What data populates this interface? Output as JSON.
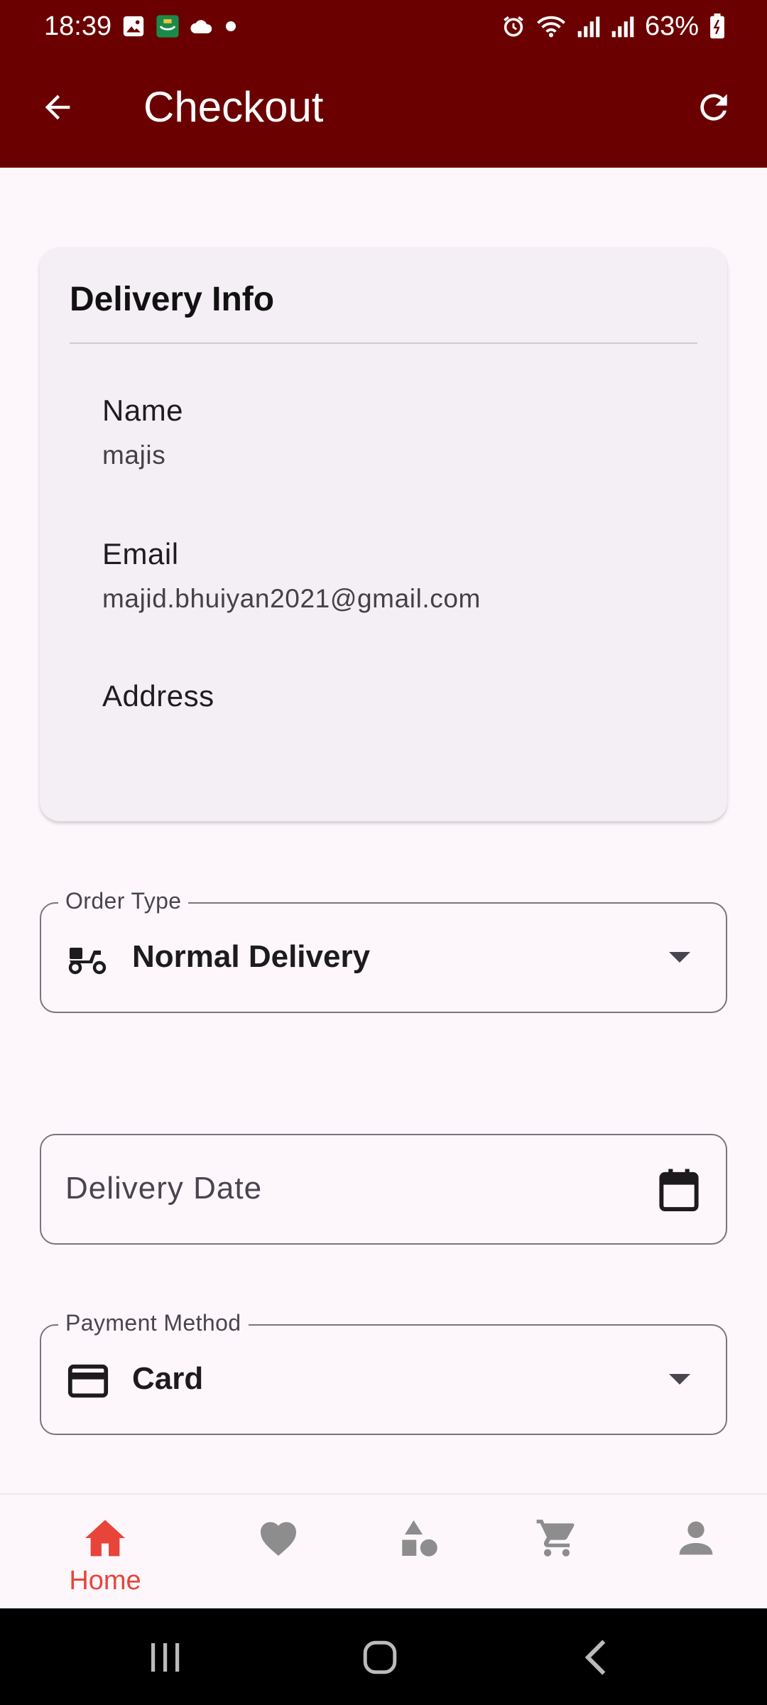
{
  "status_bar": {
    "time": "18:39",
    "battery": "63%",
    "left_icons": [
      "gallery-icon",
      "app-notification-icon",
      "cloud-icon",
      "dot-icon"
    ],
    "right_icons": [
      "alarm-icon",
      "wifi-icon",
      "signal-icon",
      "signal-icon",
      "battery-icon"
    ]
  },
  "app_bar": {
    "title": "Checkout",
    "back_icon": "arrow-left-icon",
    "refresh_icon": "refresh-icon",
    "background": "#6b0000"
  },
  "delivery_info": {
    "title": "Delivery Info",
    "name_label": "Name",
    "name_value": "majis",
    "email_label": "Email",
    "email_value": "majid.bhuiyan2021@gmail.com",
    "address_label": "Address",
    "address_value": ""
  },
  "order_type": {
    "label": "Order Type",
    "value": "Normal Delivery",
    "icon": "delivery-scooter-icon"
  },
  "delivery_date": {
    "placeholder": "Delivery Date",
    "icon": "calendar-icon"
  },
  "payment_method": {
    "label": "Payment Method",
    "value": "Card",
    "icon": "credit-card-icon"
  },
  "bottom_nav": {
    "accent": "#e8443a",
    "inactive": "#8d8d8d",
    "items": [
      {
        "label": "Home",
        "icon": "home-icon",
        "active": true
      },
      {
        "label": "",
        "icon": "heart-icon",
        "active": false
      },
      {
        "label": "",
        "icon": "categories-icon",
        "active": false
      },
      {
        "label": "",
        "icon": "cart-icon",
        "active": false
      },
      {
        "label": "",
        "icon": "profile-icon",
        "active": false
      }
    ]
  },
  "system_nav": {
    "icons": [
      "recent-apps-icon",
      "home-circle-icon",
      "back-chevron-icon"
    ]
  }
}
